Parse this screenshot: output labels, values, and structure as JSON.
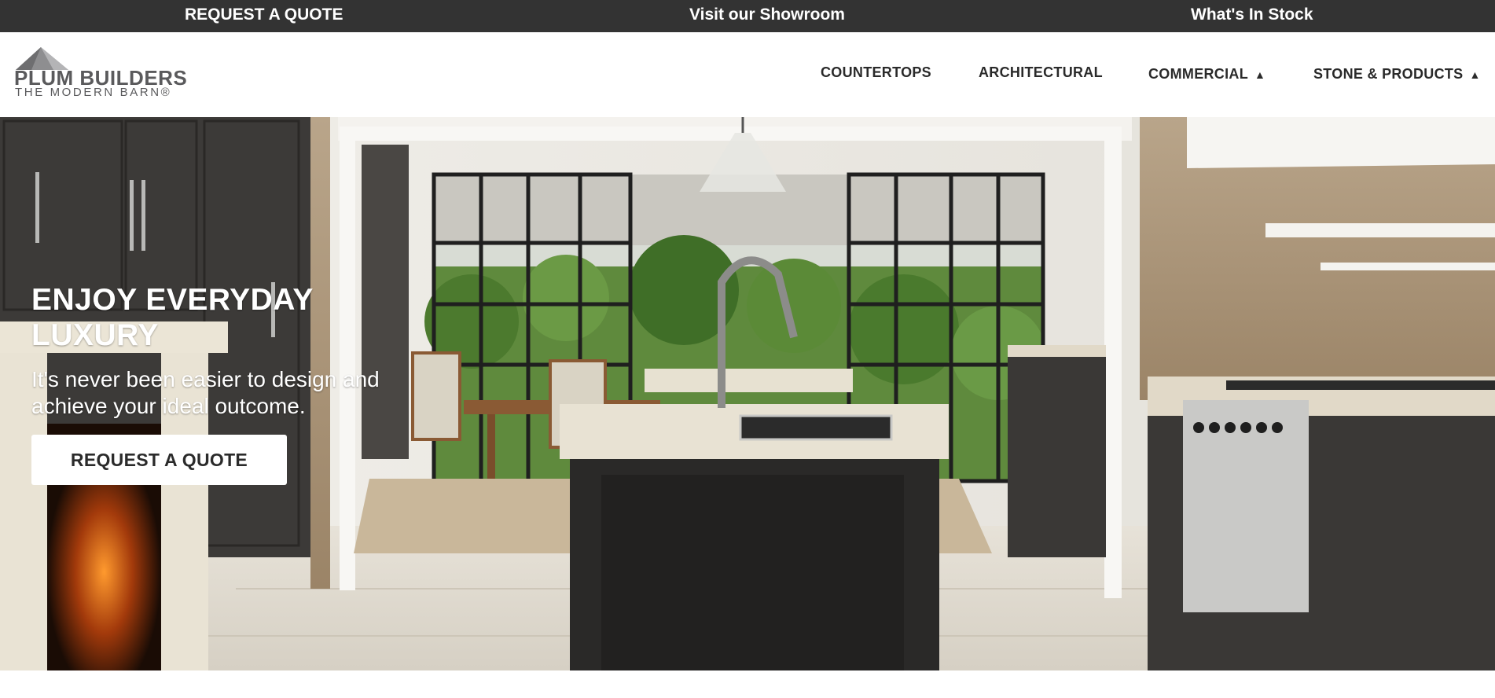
{
  "topbar": {
    "quote": "REQUEST A QUOTE",
    "showroom": "Visit our Showroom",
    "stock": "What's In Stock",
    "bg_color": "#333333"
  },
  "logo": {
    "name": "PLUM BUILDERS",
    "tagline": "THE MODERN BARN®",
    "icon": "barn-roof-icon"
  },
  "nav": {
    "items": [
      {
        "label": "COUNTERTOPS"
      },
      {
        "label": "ARCHITECTURAL"
      },
      {
        "label": "COMMERCIAL",
        "caret": "▲",
        "icon": "caret-up-icon"
      },
      {
        "label": "STONE & PRODUCTS",
        "caret": "▲",
        "icon": "caret-up-icon"
      }
    ]
  },
  "hero": {
    "title": "ENJOY EVERYDAY LUXURY",
    "subtitle": "It's never been easier to design and achieve your ideal outcome.",
    "cta_label": "REQUEST A QUOTE"
  }
}
